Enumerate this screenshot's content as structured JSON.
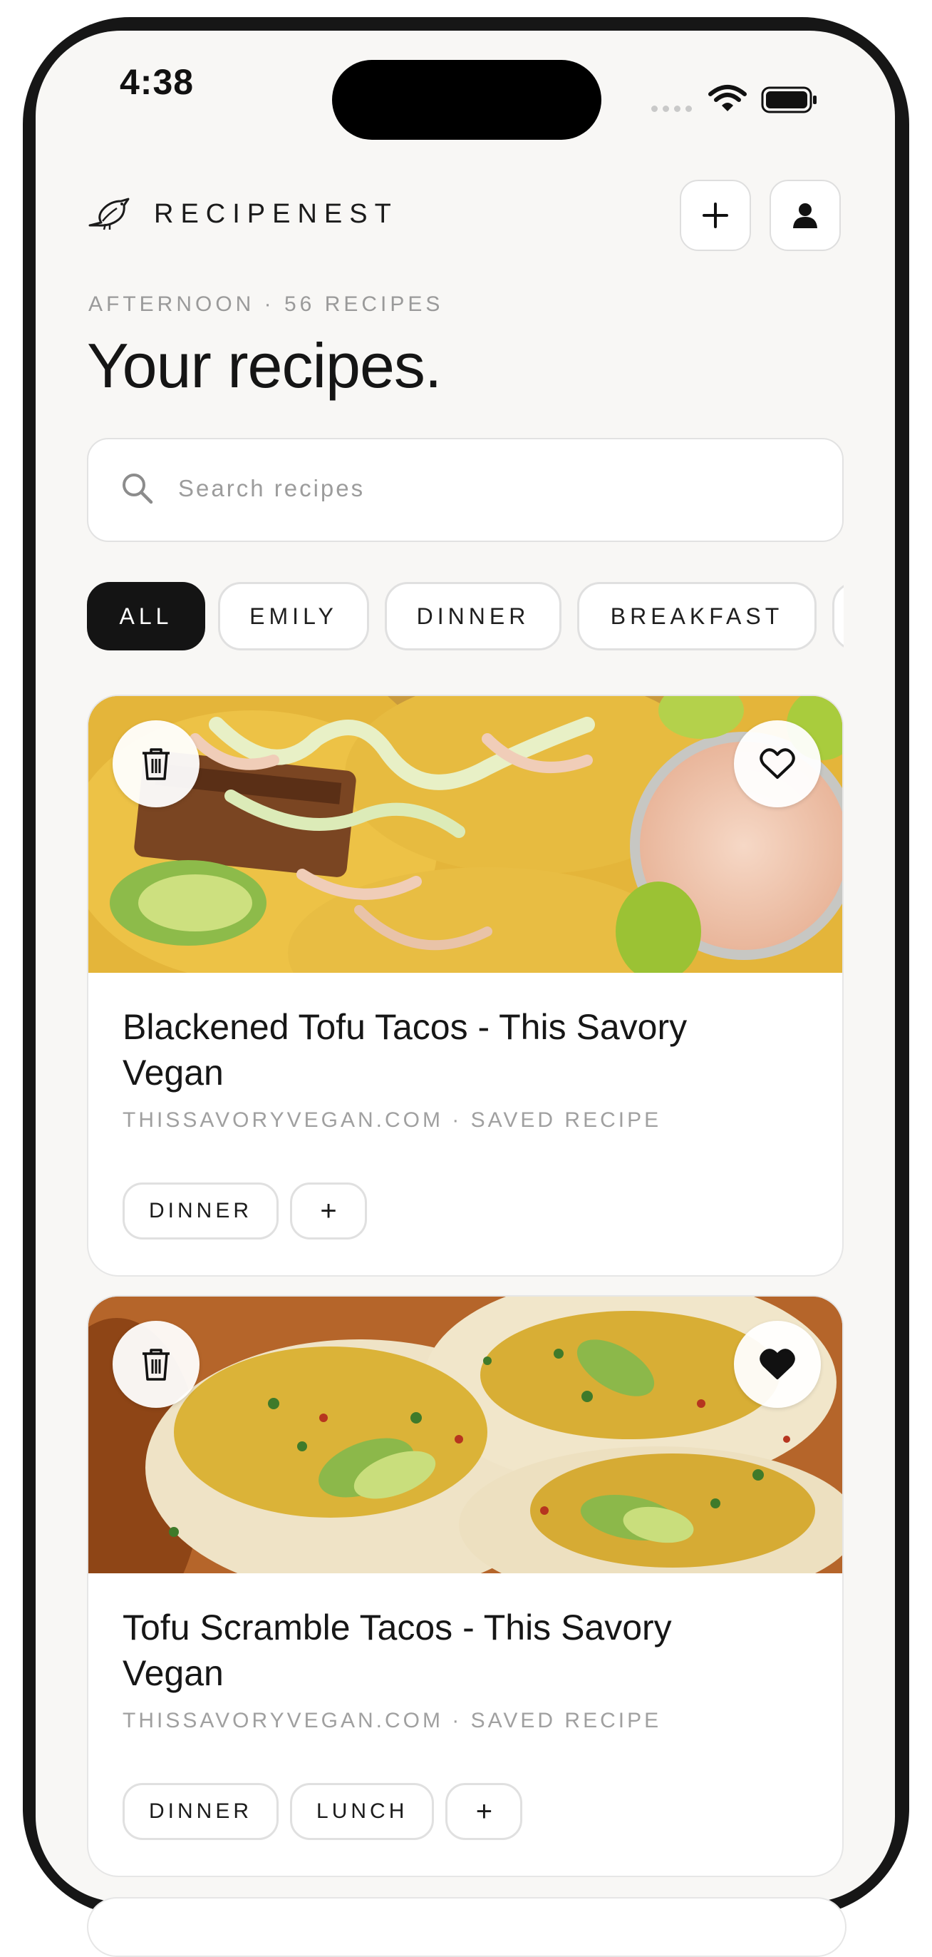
{
  "status_bar": {
    "time": "4:38"
  },
  "header": {
    "brand": "RECIPENEST",
    "kicker": "AFTERNOON · 56 RECIPES",
    "title": "Your recipes."
  },
  "search": {
    "placeholder": "Search recipes"
  },
  "filters": [
    "ALL",
    "EMILY",
    "DINNER",
    "BREAKFAST"
  ],
  "active_filter": "ALL",
  "recipes": [
    {
      "title": "Blackened Tofu Tacos - This Savory Vegan",
      "meta": "THISSAVORYVEGAN.COM · SAVED RECIPE",
      "tags": [
        "DINNER"
      ],
      "favorited": false,
      "image_icon": "tofu-tacos-photo"
    },
    {
      "title": "Tofu Scramble Tacos - This Savory Vegan",
      "meta": "THISSAVORYVEGAN.COM · SAVED RECIPE",
      "tags": [
        "DINNER",
        "LUNCH"
      ],
      "favorited": true,
      "image_icon": "scramble-tacos-photo"
    }
  ],
  "add_tag_label": "+",
  "icons": {
    "brand": "bird-icon",
    "add": "plus-icon",
    "profile": "user-icon",
    "search": "search-icon",
    "delete": "trash-icon",
    "favorite": "heart-icon"
  }
}
